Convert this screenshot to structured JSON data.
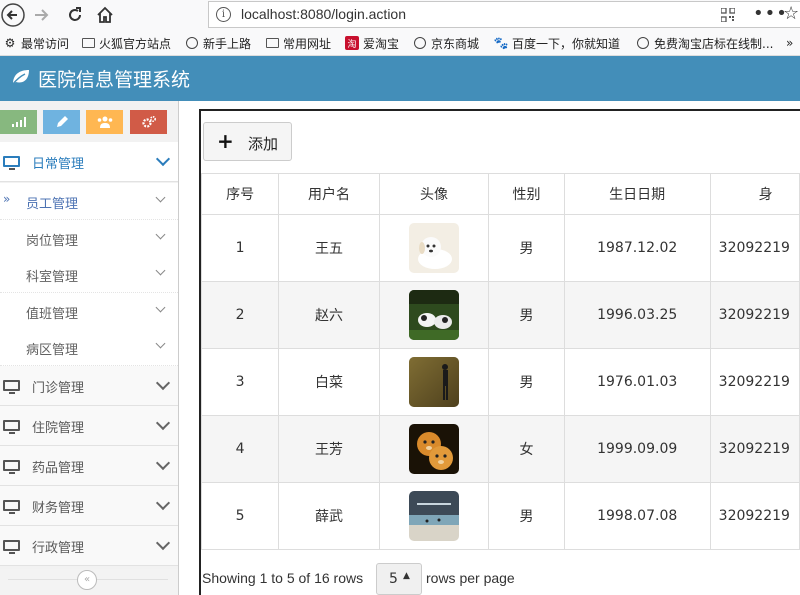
{
  "browser": {
    "url": "localhost:8080/login.action",
    "dots": "•••",
    "bookmarks": [
      {
        "label": "最常访问",
        "icon": "gear-icon"
      },
      {
        "label": "火狐官方站点",
        "icon": "folder-icon"
      },
      {
        "label": "新手上路",
        "icon": "globe-icon"
      },
      {
        "label": "常用网址",
        "icon": "folder-icon"
      },
      {
        "label": "爱淘宝",
        "icon": "taobao-icon"
      },
      {
        "label": "京东商城",
        "icon": "globe-icon"
      },
      {
        "label": "百度一下，你就知道",
        "icon": "baidu-paw-icon"
      },
      {
        "label": "免费淘宝店标在线制...",
        "icon": "globe-icon"
      }
    ]
  },
  "app": {
    "title": "医院信息管理系统",
    "header_color": "#438eb9"
  },
  "sidebar": {
    "shortcut_colors": [
      "#87b87f",
      "#6fb3e0",
      "#ffb752",
      "#d15b47"
    ],
    "shortcuts": [
      "chart-icon",
      "pencil-icon",
      "users-icon",
      "cogs-icon"
    ],
    "menu": [
      {
        "label": "日常管理",
        "active": true
      },
      {
        "label": "门诊管理"
      },
      {
        "label": "住院管理"
      },
      {
        "label": "药品管理"
      },
      {
        "label": "财务管理"
      },
      {
        "label": "行政管理"
      }
    ],
    "submenu": [
      {
        "label": "员工管理",
        "active": true
      },
      {
        "label": "岗位管理"
      },
      {
        "label": "科室管理"
      },
      {
        "label": "值班管理"
      },
      {
        "label": "病区管理"
      }
    ]
  },
  "toolbar": {
    "add_label": "添加"
  },
  "table": {
    "columns": [
      "序号",
      "用户名",
      "头像",
      "性别",
      "生日日期",
      "身"
    ],
    "rows": [
      {
        "no": "1",
        "name": "王五",
        "avatar": "white-puppy",
        "gender": "男",
        "birthday": "1987.12.02",
        "id": "32092219"
      },
      {
        "no": "2",
        "name": "赵六",
        "avatar": "dogs-on-grass",
        "gender": "男",
        "birthday": "1996.03.25",
        "id": "32092219"
      },
      {
        "no": "3",
        "name": "白菜",
        "avatar": "woman-standing",
        "gender": "男",
        "birthday": "1976.01.03",
        "id": "32092219"
      },
      {
        "no": "4",
        "name": "王芳",
        "avatar": "lion-cubs",
        "gender": "女",
        "birthday": "1999.09.09",
        "id": "32092219"
      },
      {
        "no": "5",
        "name": "薛武",
        "avatar": "beach-scene",
        "gender": "男",
        "birthday": "1998.07.08",
        "id": "32092219"
      }
    ]
  },
  "pagination": {
    "summary": "Showing 1 to 5 of 16 rows",
    "page_size": "5",
    "suffix": "rows per page"
  }
}
